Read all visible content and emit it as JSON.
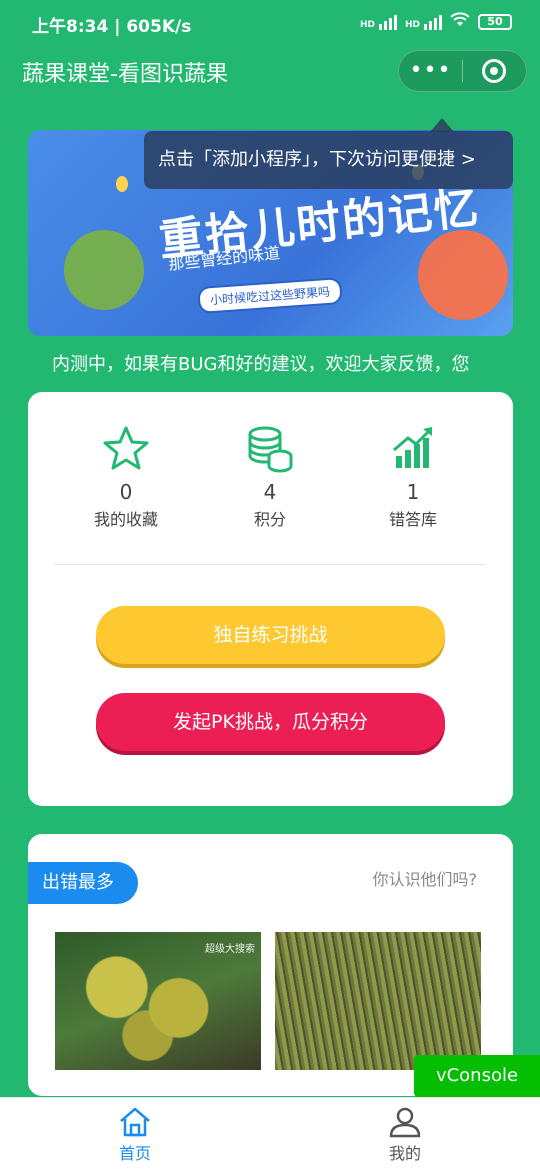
{
  "status_bar": {
    "time": "上午8:34",
    "speed": "605K/s",
    "signal1": "HD",
    "signal2": "HD",
    "battery": "50"
  },
  "nav": {
    "title": "蔬果课堂-看图识蔬果",
    "more_label": "•••"
  },
  "tooltip": {
    "text": "点击「添加小程序」，下次访问更便捷 >"
  },
  "banner": {
    "headline": "重拾儿时的记忆",
    "subline": "那些曾经的味道",
    "tag": "小时候吃过这些野果吗"
  },
  "notice": {
    "text": "内测中，如果有BUG和好的建议，欢迎大家反馈，您"
  },
  "stats": {
    "items": [
      {
        "value": "0",
        "label": "我的收藏",
        "icon": "star-icon"
      },
      {
        "value": "4",
        "label": "积分",
        "icon": "coins-icon"
      },
      {
        "value": "1",
        "label": "错答库",
        "icon": "chart-up-icon"
      }
    ]
  },
  "buttons": {
    "solo": "独自练习挑战",
    "pk": "发起PK挑战，瓜分积分"
  },
  "wrong_section": {
    "badge": "出错最多",
    "hint": "你认识他们吗?",
    "photo1_watermark": "超级大搜索",
    "photo2_watermark": ""
  },
  "vconsole": {
    "label": "vConsole"
  },
  "tabbar": {
    "home": "首页",
    "mine": "我的"
  },
  "colors": {
    "theme_green": "#22b871",
    "accent_blue": "#1a8cf0",
    "button_yellow": "#fdc830",
    "button_red": "#ec1f55",
    "vconsole_green": "#04be02"
  }
}
